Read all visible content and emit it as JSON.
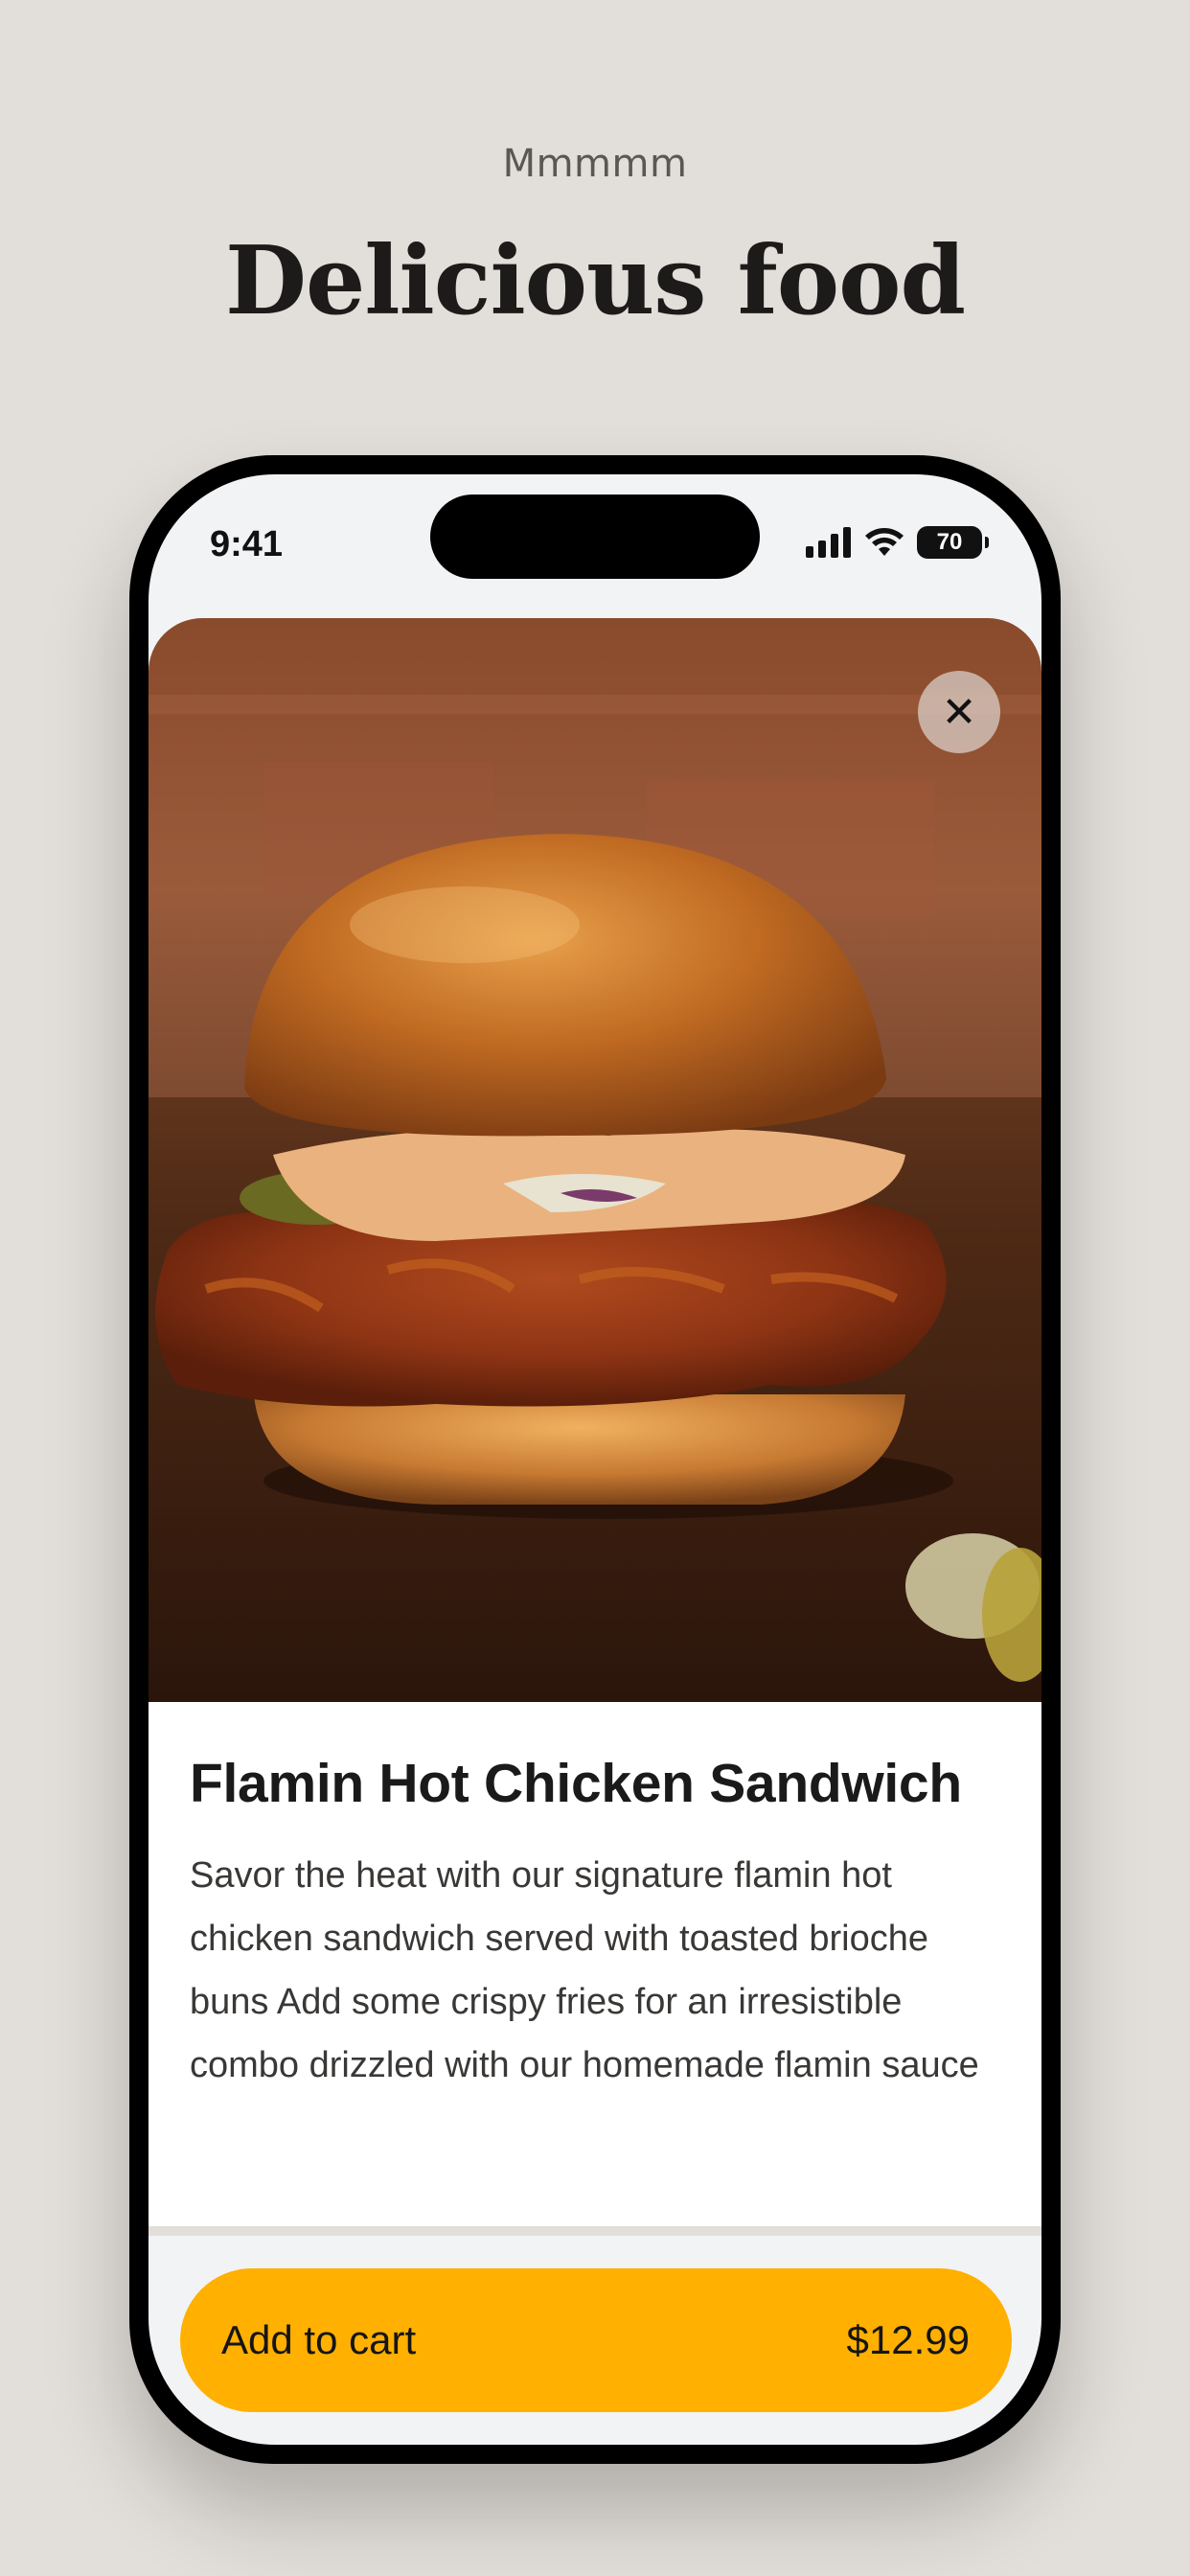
{
  "header": {
    "eyebrow": "Mmmmm",
    "title": "Delicious food"
  },
  "status_bar": {
    "time": "9:41",
    "battery": "70",
    "icons": [
      "cellular-signal-icon",
      "wifi-icon",
      "battery-icon"
    ]
  },
  "product": {
    "image": "fried-chicken-sandwich-photo",
    "name": "Flamin Hot Chicken Sandwich",
    "description": "Savor the heat with our signature flamin hot chicken sandwich served with toasted brioche buns Add some crispy fries for an irresistible combo drizzled with our homemade flamin sauce"
  },
  "close": {
    "icon": "close-icon",
    "glyph": "✕"
  },
  "cart": {
    "label": "Add to cart",
    "price": "$12.99"
  },
  "colors": {
    "background": "#e2ded9",
    "accent": "#ffb000",
    "text": "#1a1a1a"
  }
}
